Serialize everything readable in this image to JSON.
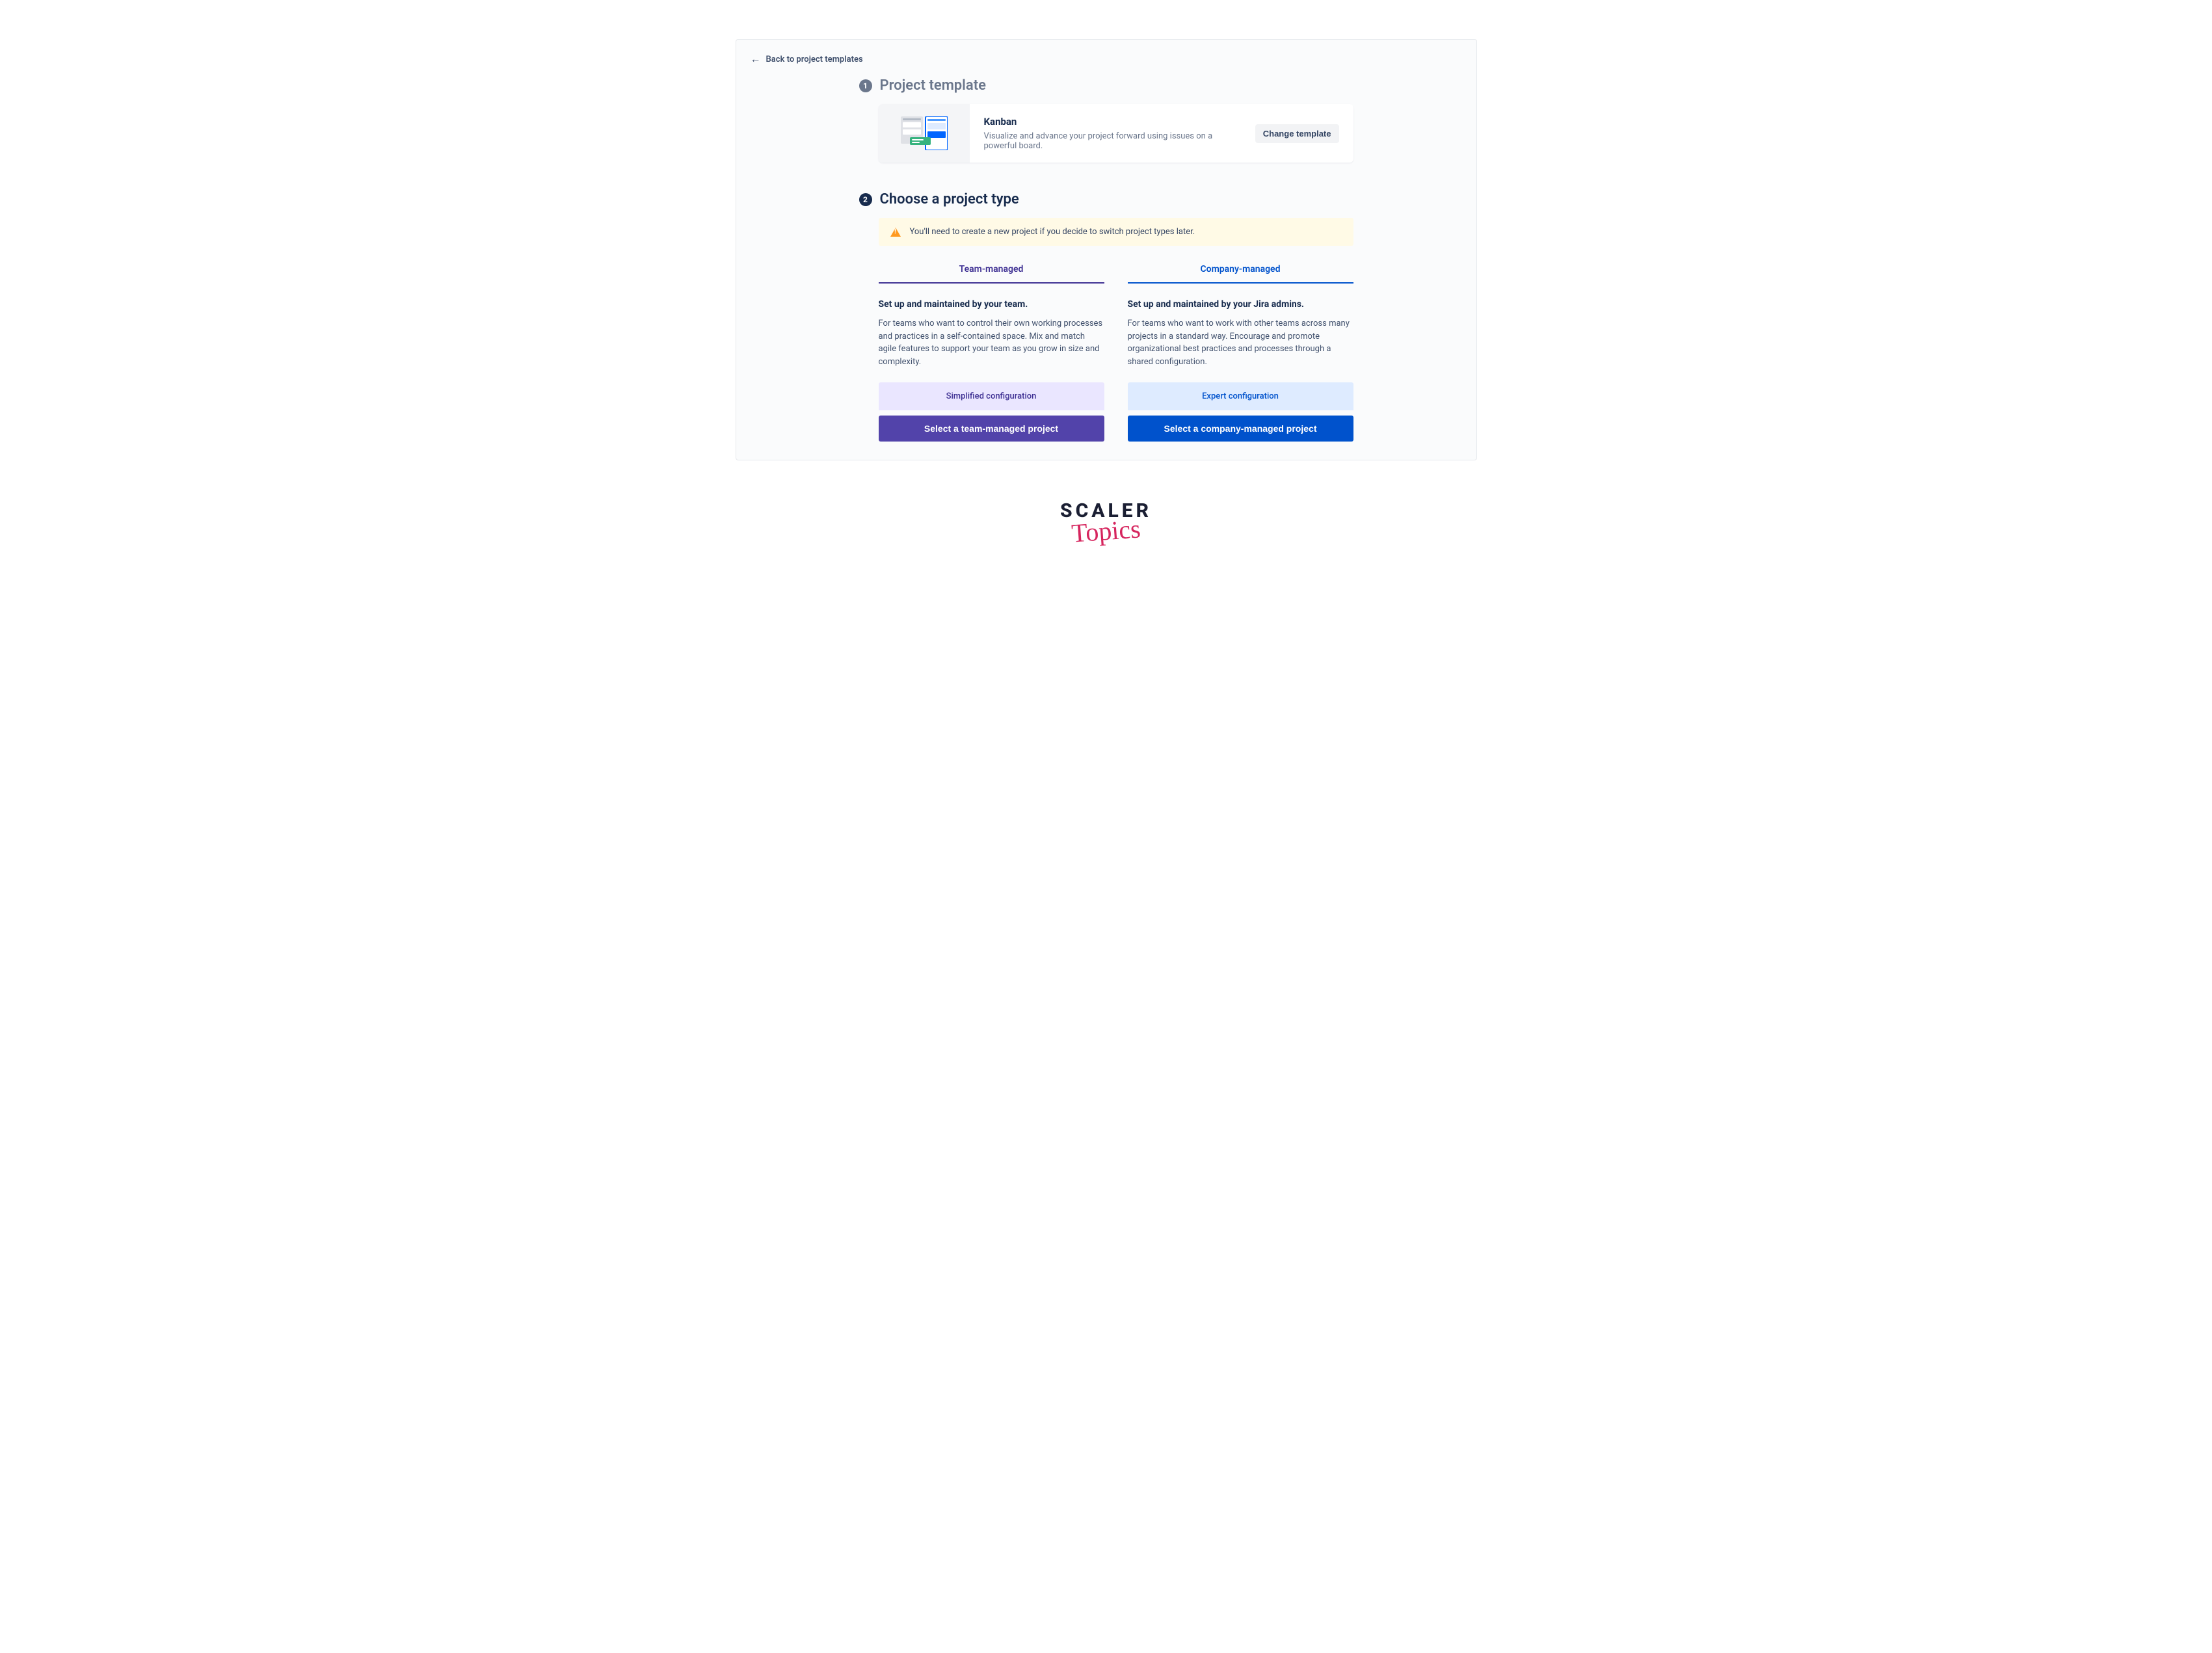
{
  "back_link": {
    "label": "Back to project templates"
  },
  "step1": {
    "badge": "1",
    "title": "Project template",
    "template": {
      "name": "Kanban",
      "desc": "Visualize and advance your project forward using issues on a powerful board.",
      "change_btn": "Change template"
    }
  },
  "step2": {
    "badge": "2",
    "title": "Choose a project type",
    "warning": "You'll need to create a new project if you decide to switch project types later."
  },
  "team": {
    "heading": "Team-managed",
    "subtitle": "Set up and maintained by your team.",
    "body": "For teams who want to control their own working processes and practices in a self-contained space. Mix and match agile features to support your team as you grow in size and complexity.",
    "config": "Simplified configuration",
    "select": "Select a team-managed project"
  },
  "company": {
    "heading": "Company-managed",
    "subtitle": "Set up and maintained by your Jira admins.",
    "body": "For teams who want to work with other teams across many projects in a standard way. Encourage and promote organizational best practices and processes through a shared configuration.",
    "config": "Expert configuration",
    "select": "Select a company-managed project"
  },
  "brand": {
    "line1": "SCALER",
    "line2": "Topics"
  }
}
